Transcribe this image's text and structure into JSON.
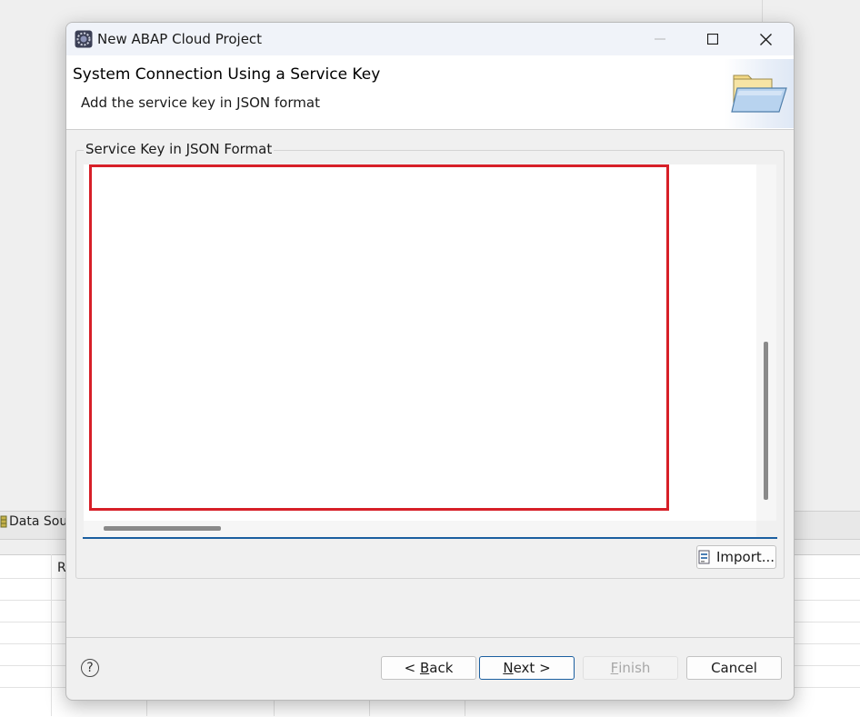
{
  "background": {
    "tab_label": "Data Sou",
    "column_header": "R"
  },
  "dialog": {
    "title": "New ABAP Cloud Project",
    "window_controls": {
      "minimize": "—",
      "maximize": "☐",
      "close": "✕"
    },
    "header": {
      "title": "System Connection Using a Service Key",
      "description": "Add the service key in JSON format",
      "icon": "folder-icon"
    },
    "group_label": "Service Key in JSON Format",
    "service_key_value": "",
    "import_label": "Import...",
    "buttons": {
      "help": "?",
      "back_prefix": "< ",
      "back_mnemonic": "B",
      "back_rest": "ack",
      "next_mnemonic": "N",
      "next_rest": "ext >",
      "finish_mnemonic": "F",
      "finish_rest": "inish",
      "cancel": "Cancel"
    }
  },
  "colors": {
    "highlight": "#d71f28",
    "accent": "#1b5fa0"
  }
}
